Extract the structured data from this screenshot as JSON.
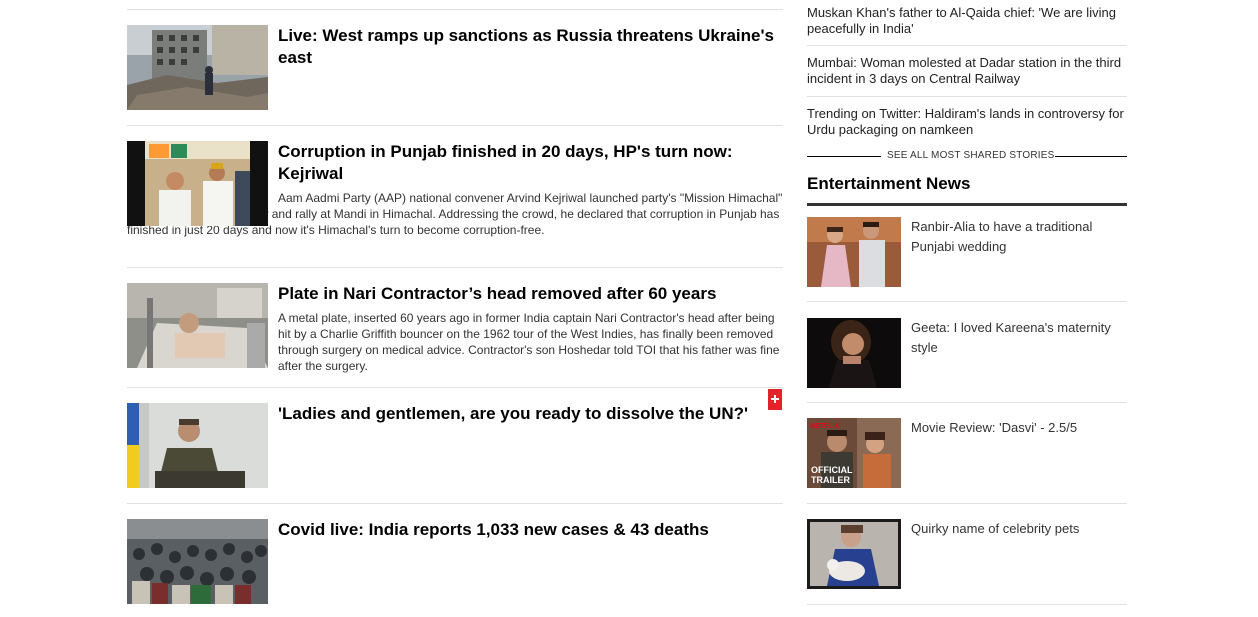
{
  "stories": [
    {
      "headline": "Live: West ramps up sanctions as Russia threatens Ukraine's east",
      "summary": "",
      "image_icon": "bombed-building-image"
    },
    {
      "headline": "Corruption in Punjab finished in 20 days, HP's turn now: Kejriwal",
      "summary": "Aam Aadmi Party (AAP) national convener Arvind Kejriwal launched party's \"Mission Himachal\" with its first ever roadshow and rally at Mandi in Himachal. Addressing the crowd, he declared that corruption in Punjab has finished in just 20 days and now it's Himachal's turn to become corruption-free.",
      "image_icon": "kejriwal-rally-image"
    },
    {
      "headline": "Plate in Nari Contractor’s head removed after 60 years",
      "summary": "A metal plate, inserted 60 years ago in former India captain Nari Contractor's head after being hit by a Charlie Griffith bouncer on the 1962 tour of the West Indies, has finally been removed through surgery on medical advice. Contractor's son Hoshedar told TOI that his father was fine after the surgery.",
      "image_icon": "hospital-bed-image"
    },
    {
      "headline": "'Ladies and gentlemen, are you ready to dissolve the UN?'",
      "summary": "",
      "image_icon": "zelensky-address-image"
    },
    {
      "headline": "Covid live: India reports 1,033 new cases & 43 deaths",
      "summary": "",
      "image_icon": "crowd-image"
    }
  ],
  "most_shared": [
    "Muskan Khan's father to Al-Qaida chief: 'We are living peacefully in India'",
    "Mumbai: Woman molested at Dadar station in the third incident in 3 days on Central Railway",
    "Trending on Twitter: Haldiram's lands in controversy for Urdu packaging on namkeen"
  ],
  "see_all_label": "SEE ALL MOST SHARED STORIES",
  "entertainment": {
    "title": "Entertainment News",
    "items": [
      {
        "title": "Ranbir-Alia to have a traditional Punjabi wedding",
        "image_icon": "couple-photo-image"
      },
      {
        "title": "Geeta: I loved Kareena's maternity style",
        "image_icon": "actress-portrait-image"
      },
      {
        "title": "Movie Review: 'Dasvi' - 2.5/5",
        "image_icon": "movie-trailer-image",
        "badge_top": "NETFLIX",
        "badge_bottom_1": "OFFICIAL",
        "badge_bottom_2": "TRAILER"
      },
      {
        "title": "Quirky name of celebrity pets",
        "image_icon": "celebrity-pet-image"
      }
    ]
  },
  "colors": {
    "ad_badge": "#e0242a",
    "section_bar": "#333333",
    "rule": "#e0e0e0"
  }
}
